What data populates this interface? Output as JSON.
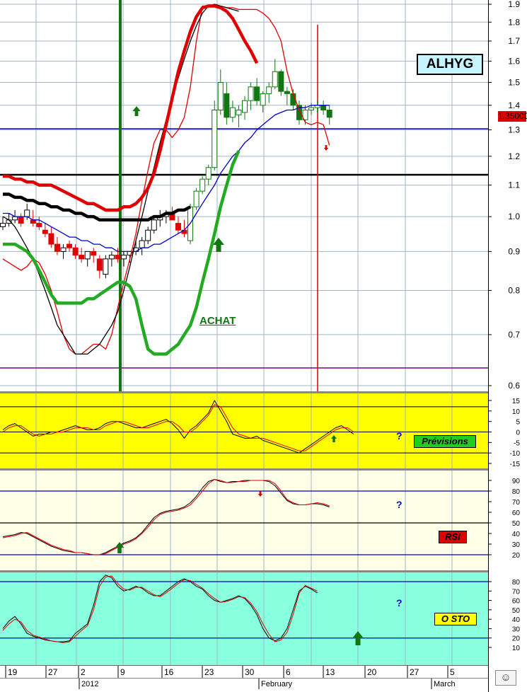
{
  "ticker": "ALHYG",
  "last_price_tag": "1.35000",
  "achat_label": "ACHAT",
  "panels": {
    "previsions": {
      "label": "Prévisions",
      "bg": "#ffff00",
      "label_bg": "#22cc22",
      "yticks": [
        "15",
        "10",
        "5",
        "0",
        "-5",
        "-10",
        "-15"
      ],
      "question": "?"
    },
    "rsi": {
      "label": "RSI",
      "bg": "#ffffe8",
      "label_bg": "#e00000",
      "yticks": [
        "90",
        "80",
        "70",
        "60",
        "50",
        "40",
        "30",
        "20"
      ],
      "question": "?"
    },
    "sto": {
      "label": "O STO",
      "bg": "#88ffdd",
      "label_bg": "#ffff00",
      "yticks": [
        "80",
        "70",
        "60",
        "50",
        "40",
        "30",
        "20",
        "10"
      ],
      "question": "?"
    }
  },
  "x_axis": {
    "day_ticks": [
      "19",
      "27",
      "2",
      "9",
      "16",
      "23",
      "30",
      "6",
      "13",
      "20",
      "27",
      "5"
    ],
    "month_labels": [
      "2012",
      "February",
      "March"
    ]
  },
  "smiley": "☺",
  "chart_data": [
    {
      "type": "candlestick",
      "title": "ALHYG",
      "y_ticks": [
        1.9,
        1.8,
        1.7,
        1.6,
        1.5,
        1.4,
        1.3,
        1.2,
        1.1,
        1.0,
        0.9,
        0.8,
        0.7,
        0.6
      ],
      "ylim": [
        0.6,
        1.9
      ],
      "y_scale": "log",
      "grid": true,
      "last_price": 1.35,
      "x_start": "2011-12-16",
      "candles": [
        [
          0.97,
          1.0,
          0.96,
          0.98
        ],
        [
          0.98,
          1.01,
          0.97,
          0.99
        ],
        [
          0.99,
          1.02,
          0.98,
          1.0
        ],
        [
          1.0,
          1.01,
          0.97,
          0.98
        ],
        [
          1.0,
          1.04,
          0.99,
          1.02
        ],
        [
          0.99,
          1.02,
          0.97,
          0.98
        ],
        [
          0.98,
          1.0,
          0.96,
          0.97
        ],
        [
          0.96,
          0.98,
          0.94,
          0.95
        ],
        [
          0.95,
          0.97,
          0.91,
          0.92
        ],
        [
          0.92,
          0.94,
          0.89,
          0.9
        ],
        [
          0.9,
          0.92,
          0.88,
          0.91
        ],
        [
          0.92,
          0.93,
          0.9,
          0.91
        ],
        [
          0.91,
          0.92,
          0.88,
          0.89
        ],
        [
          0.89,
          0.91,
          0.87,
          0.88
        ],
        [
          0.88,
          0.9,
          0.86,
          0.9
        ],
        [
          0.9,
          0.91,
          0.87,
          0.89
        ],
        [
          0.88,
          0.89,
          0.83,
          0.85
        ],
        [
          0.84,
          0.89,
          0.83,
          0.88
        ],
        [
          0.88,
          0.9,
          0.86,
          0.89
        ],
        [
          0.89,
          0.91,
          0.87,
          0.88
        ],
        [
          0.88,
          0.9,
          0.86,
          0.89
        ],
        [
          0.89,
          0.9,
          0.87,
          0.9
        ],
        [
          0.9,
          0.93,
          0.89,
          0.91
        ],
        [
          0.91,
          0.94,
          0.89,
          0.93
        ],
        [
          0.93,
          0.97,
          0.92,
          0.96
        ],
        [
          0.96,
          1.0,
          0.95,
          0.99
        ],
        [
          0.99,
          1.02,
          0.97,
          1.0
        ],
        [
          1.0,
          1.02,
          0.98,
          1.01
        ],
        [
          1.01,
          1.03,
          0.99,
          0.99
        ],
        [
          0.98,
          1.0,
          0.95,
          0.96
        ],
        [
          0.96,
          0.99,
          0.94,
          0.95
        ],
        [
          0.93,
          1.04,
          0.92,
          1.03
        ],
        [
          1.03,
          1.09,
          1.02,
          1.08
        ],
        [
          1.08,
          1.13,
          1.07,
          1.12
        ],
        [
          1.12,
          1.17,
          1.1,
          1.16
        ],
        [
          1.16,
          1.42,
          1.15,
          1.38
        ],
        [
          1.38,
          1.56,
          1.36,
          1.5
        ],
        [
          1.45,
          1.5,
          1.32,
          1.35
        ],
        [
          1.35,
          1.42,
          1.33,
          1.39
        ],
        [
          1.36,
          1.4,
          1.31,
          1.38
        ],
        [
          1.37,
          1.44,
          1.34,
          1.42
        ],
        [
          1.42,
          1.5,
          1.38,
          1.48
        ],
        [
          1.48,
          1.52,
          1.4,
          1.42
        ],
        [
          1.4,
          1.46,
          1.37,
          1.45
        ],
        [
          1.45,
          1.5,
          1.41,
          1.48
        ],
        [
          1.48,
          1.61,
          1.47,
          1.55
        ],
        [
          1.55,
          1.56,
          1.44,
          1.46
        ],
        [
          1.46,
          1.48,
          1.4,
          1.45
        ],
        [
          1.45,
          1.47,
          1.38,
          1.4
        ],
        [
          1.4,
          1.42,
          1.32,
          1.34
        ],
        [
          1.34,
          1.4,
          1.32,
          1.38
        ],
        [
          1.38,
          1.41,
          1.36,
          1.39
        ],
        [
          1.39,
          1.42,
          1.37,
          1.4
        ],
        [
          1.4,
          1.42,
          1.36,
          1.38
        ],
        [
          1.38,
          1.4,
          1.32,
          1.35
        ]
      ],
      "series": [
        {
          "color": "#0000cc",
          "width": 1.3,
          "values": [
            1.01,
            1.01,
            1.0,
            1.0,
            1.0,
            0.99,
            0.99,
            0.98,
            0.97,
            0.96,
            0.95,
            0.94,
            0.94,
            0.93,
            0.93,
            0.92,
            0.92,
            0.91,
            0.91,
            0.9,
            0.9,
            0.9,
            0.9,
            0.91,
            0.91,
            0.92,
            0.92,
            0.93,
            0.94,
            0.95,
            0.96,
            0.98,
            1.01,
            1.04,
            1.07,
            1.1,
            1.14,
            1.17,
            1.2,
            1.22,
            1.25,
            1.27,
            1.3,
            1.32,
            1.34,
            1.36,
            1.37,
            1.38,
            1.38,
            1.39,
            1.39,
            1.4,
            1.4,
            1.4,
            1.4
          ]
        },
        {
          "color": "#e00000",
          "width": 1.3,
          "values": [
            0.88,
            0.87,
            0.86,
            0.85,
            0.86,
            0.88,
            0.87,
            0.84,
            0.8,
            0.75,
            0.7,
            0.67,
            0.66,
            0.66,
            0.67,
            0.68,
            0.68,
            0.67,
            0.7,
            0.76,
            0.82,
            0.88,
            0.95,
            1.05,
            1.15,
            1.25,
            1.3,
            1.3,
            1.27,
            1.3,
            1.35,
            1.48,
            1.7,
            1.89,
            1.89,
            1.89,
            1.89,
            1.88,
            1.88,
            1.87,
            1.87,
            1.87,
            1.87,
            1.85,
            1.82,
            1.77,
            1.7,
            1.55,
            1.45,
            1.38,
            1.33,
            1.32,
            1.33,
            1.32,
            1.24
          ]
        },
        {
          "color": "#000000",
          "width": 1.3,
          "values": [
            1.0,
            0.99,
            0.97,
            0.94,
            0.91,
            0.88,
            0.84,
            0.8,
            0.76,
            0.72,
            0.7,
            0.68,
            0.66,
            0.66,
            0.66,
            0.67,
            0.68,
            0.7,
            0.72,
            0.75,
            0.8,
            0.86,
            0.93,
            1.0,
            1.08,
            1.16,
            1.25,
            1.34,
            1.43,
            1.52,
            1.61,
            1.7,
            1.78,
            1.85,
            1.89,
            1.9,
            1.89,
            1.88,
            1.87,
            1.86
          ]
        },
        {
          "color": "#e00000",
          "width": 4.5,
          "values": [
            1.13,
            1.13,
            1.12,
            1.12,
            1.11,
            1.11,
            1.1,
            1.1,
            1.1,
            1.09,
            1.08,
            1.07,
            1.06,
            1.05,
            1.04,
            1.04,
            1.03,
            1.02,
            1.02,
            1.02,
            1.03,
            1.03,
            1.04,
            1.06,
            1.09,
            1.14,
            1.22,
            1.32,
            1.43,
            1.55,
            1.65,
            1.75,
            1.83,
            1.88,
            1.89,
            1.89,
            1.88,
            1.86,
            1.82,
            1.76,
            1.7,
            1.65,
            1.59
          ]
        },
        {
          "color": "#000000",
          "width": 4.5,
          "values": [
            1.07,
            1.07,
            1.06,
            1.06,
            1.05,
            1.05,
            1.04,
            1.04,
            1.03,
            1.03,
            1.02,
            1.02,
            1.01,
            1.01,
            1.0,
            1.0,
            0.99,
            0.99,
            0.99,
            0.99,
            0.99,
            0.99,
            0.99,
            0.99,
            0.99,
            1.0,
            1.0,
            1.01,
            1.01,
            1.02,
            1.02,
            1.03
          ]
        },
        {
          "color": "#22aa22",
          "width": 4.5,
          "values": [
            0.92,
            0.92,
            0.92,
            0.91,
            0.9,
            0.88,
            0.85,
            0.82,
            0.79,
            0.77,
            0.77,
            0.77,
            0.77,
            0.77,
            0.78,
            0.78,
            0.79,
            0.8,
            0.81,
            0.82,
            0.82,
            0.81,
            0.78,
            0.72,
            0.67,
            0.66,
            0.66,
            0.66,
            0.67,
            0.68,
            0.7,
            0.72,
            0.76,
            0.82,
            0.88,
            0.95,
            1.03,
            1.1,
            1.17,
            1.22
          ]
        }
      ]
    },
    {
      "type": "line",
      "title": "Prévisions",
      "ylim": [
        -15,
        15
      ],
      "y_ticks": [
        15,
        10,
        5,
        0,
        -5,
        -10,
        -15
      ],
      "x_start": "2011-12-16",
      "series": [
        {
          "color": "#000000",
          "values": [
            1,
            3,
            4,
            2,
            0,
            -2,
            -1,
            -1,
            0,
            0,
            1,
            2,
            3,
            2,
            1,
            1,
            2,
            4,
            5,
            5,
            4,
            3,
            2,
            2,
            3,
            4,
            5,
            6,
            4,
            1,
            -3,
            1,
            3,
            6,
            9,
            15,
            10,
            5,
            -1,
            -2,
            -3,
            -3,
            -2,
            -4,
            -5,
            -6,
            -7,
            -8,
            -9,
            -10,
            -8,
            -6,
            -4,
            -2,
            0,
            2,
            3,
            1,
            -1
          ]
        },
        {
          "color": "#e00000",
          "values": [
            0,
            2,
            3,
            3,
            1,
            -1,
            -2,
            -1,
            -1,
            0,
            0,
            1,
            2,
            2,
            2,
            1,
            1,
            3,
            4,
            5,
            5,
            4,
            3,
            2,
            2,
            3,
            4,
            5,
            5,
            3,
            0,
            0,
            2,
            5,
            8,
            13,
            12,
            7,
            2,
            -1,
            -2,
            -3,
            -3,
            -3,
            -4,
            -5,
            -6,
            -7,
            -8,
            -9,
            -9,
            -7,
            -5,
            -3,
            -1,
            1,
            2,
            2,
            0
          ]
        }
      ]
    },
    {
      "type": "line",
      "title": "RSI",
      "ylim": [
        15,
        95
      ],
      "y_ticks": [
        90,
        80,
        70,
        60,
        50,
        40,
        30,
        20
      ],
      "x_start": "2011-12-16",
      "series": [
        {
          "color": "#000000",
          "values": [
            37,
            38,
            39,
            41,
            40,
            37,
            34,
            31,
            28,
            26,
            24,
            23,
            22,
            22,
            21,
            20,
            20,
            22,
            25,
            28,
            31,
            33,
            36,
            41,
            48,
            55,
            59,
            61,
            62,
            63,
            65,
            69,
            75,
            83,
            89,
            91,
            89,
            88,
            89,
            89,
            90,
            90,
            90,
            90,
            89,
            85,
            78,
            71,
            68,
            67,
            67,
            68,
            68,
            67,
            65
          ]
        },
        {
          "color": "#e00000",
          "values": [
            36,
            37,
            38,
            40,
            41,
            38,
            35,
            32,
            29,
            27,
            25,
            24,
            22,
            22,
            21,
            20,
            20,
            21,
            24,
            27,
            30,
            32,
            35,
            40,
            46,
            53,
            58,
            60,
            61,
            62,
            64,
            67,
            73,
            80,
            87,
            91,
            90,
            88,
            88,
            89,
            89,
            90,
            90,
            90,
            90,
            87,
            80,
            72,
            69,
            67,
            67,
            68,
            69,
            68,
            66
          ]
        }
      ]
    },
    {
      "type": "line",
      "title": "O STO",
      "ylim": [
        5,
        85
      ],
      "y_ticks": [
        80,
        70,
        60,
        50,
        40,
        30,
        20,
        10
      ],
      "x_start": "2011-12-16",
      "series": [
        {
          "color": "#000000",
          "values": [
            30,
            38,
            43,
            35,
            25,
            22,
            20,
            18,
            17,
            16,
            16,
            17,
            25,
            30,
            35,
            55,
            80,
            87,
            84,
            75,
            70,
            72,
            75,
            73,
            68,
            65,
            65,
            70,
            75,
            80,
            83,
            80,
            75,
            72,
            65,
            60,
            58,
            60,
            62,
            65,
            62,
            55,
            45,
            30,
            20,
            17,
            20,
            30,
            50,
            70,
            75,
            72,
            68
          ]
        },
        {
          "color": "#e00000",
          "values": [
            28,
            35,
            40,
            37,
            28,
            23,
            21,
            19,
            17,
            16,
            15,
            16,
            22,
            28,
            33,
            50,
            75,
            85,
            86,
            78,
            72,
            71,
            74,
            74,
            70,
            66,
            64,
            68,
            73,
            78,
            82,
            81,
            77,
            73,
            67,
            62,
            58,
            59,
            61,
            64,
            63,
            57,
            48,
            35,
            24,
            16,
            18,
            26,
            45,
            68,
            76,
            73,
            70
          ]
        }
      ]
    }
  ]
}
